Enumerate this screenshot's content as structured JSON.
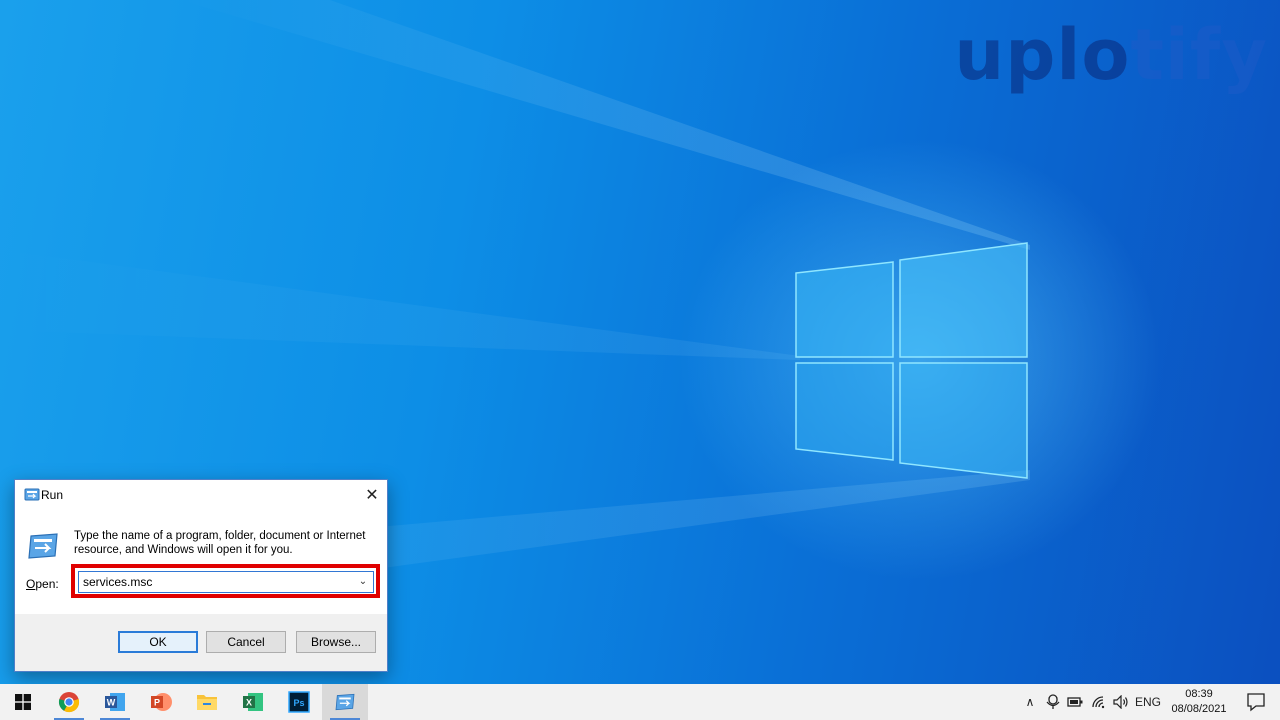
{
  "watermark": {
    "head": "uplo",
    "tail": "tify"
  },
  "run_dialog": {
    "title": "Run",
    "close_glyph": "✕",
    "description": "Type the name of a program, folder, document or Internet resource, and Windows will open it for you.",
    "open_label_accel": "O",
    "open_label_rest": "pen:",
    "input_value": "services.msc",
    "buttons": {
      "ok": "OK",
      "cancel": "Cancel",
      "browse": "Browse..."
    }
  },
  "taskbar": {
    "apps": [
      {
        "name": "start",
        "icon": "windows-logo-icon"
      },
      {
        "name": "chrome",
        "icon": "chrome-icon"
      },
      {
        "name": "word",
        "icon": "word-icon",
        "letter": "W"
      },
      {
        "name": "powerpoint",
        "icon": "powerpoint-icon",
        "letter": "P"
      },
      {
        "name": "file-explorer",
        "icon": "folder-icon"
      },
      {
        "name": "excel",
        "icon": "excel-icon",
        "letter": "X"
      },
      {
        "name": "photoshop",
        "icon": "photoshop-icon",
        "letter": "Ps"
      },
      {
        "name": "run",
        "icon": "run-icon"
      }
    ],
    "tray": {
      "language": "ENG",
      "time": "08:39",
      "date": "08/08/2021"
    }
  },
  "colors": {
    "highlight": "#e00000",
    "word": "#2b579a",
    "powerpoint": "#d24726",
    "excel": "#217346",
    "photoshop": "#001e36",
    "folder": "#f8c33a"
  }
}
